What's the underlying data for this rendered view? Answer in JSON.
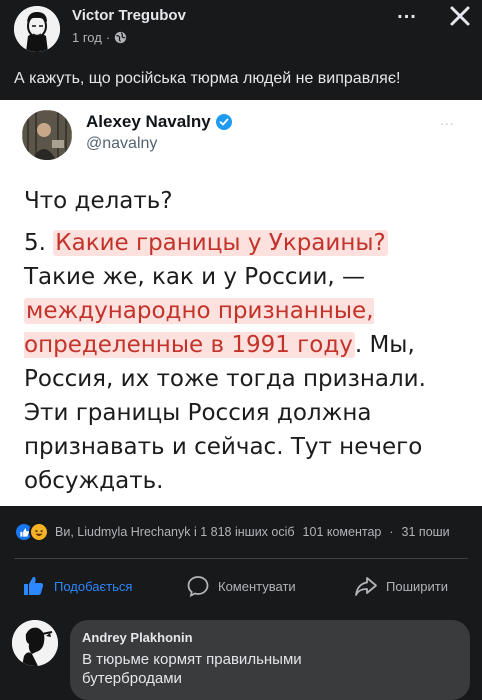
{
  "post": {
    "author": "Victor Tregubov",
    "time": "1 год",
    "separator": "·",
    "more_label": "...",
    "text": "А кажуть, що російська тюрма людей не виправляє!"
  },
  "tweet": {
    "name": "Alexey Navalny",
    "handle": "@navalny",
    "more_label": "...",
    "line1": "Что делать?",
    "p2_a": "5. ",
    "p2_hl1": "Какие границы у Украины?",
    "p2_b": " Такие же, как и у России, — ",
    "p2_hl2": "международно признанные, определенные в 1991 году",
    "p2_c": ". Мы, Россия, их тоже тогда признали. Эти границы Россия должна признавать и сейчас. Тут нечего обсуждать."
  },
  "reactions": {
    "summary": "Ви, Liudmyla Hrechanyk і 1 818 інших осіб",
    "comments": "101 коментар",
    "dot": "·",
    "shares": "31 поши"
  },
  "actions": {
    "like": "Подобається",
    "comment": "Коментувати",
    "share": "Поширити"
  },
  "comment": {
    "author": "Andrey Plakhonin",
    "text": "В тюрьме кормят правильными бутербродами"
  },
  "colors": {
    "background": "#18191a",
    "accent": "#2d88ff",
    "highlight_text": "#c2332a",
    "highlight_bg": "#fde1df"
  },
  "icons": [
    "globe-icon",
    "close-icon",
    "verified-icon",
    "like-icon",
    "comment-icon",
    "share-icon",
    "like-reaction-icon",
    "haha-reaction-icon"
  ]
}
